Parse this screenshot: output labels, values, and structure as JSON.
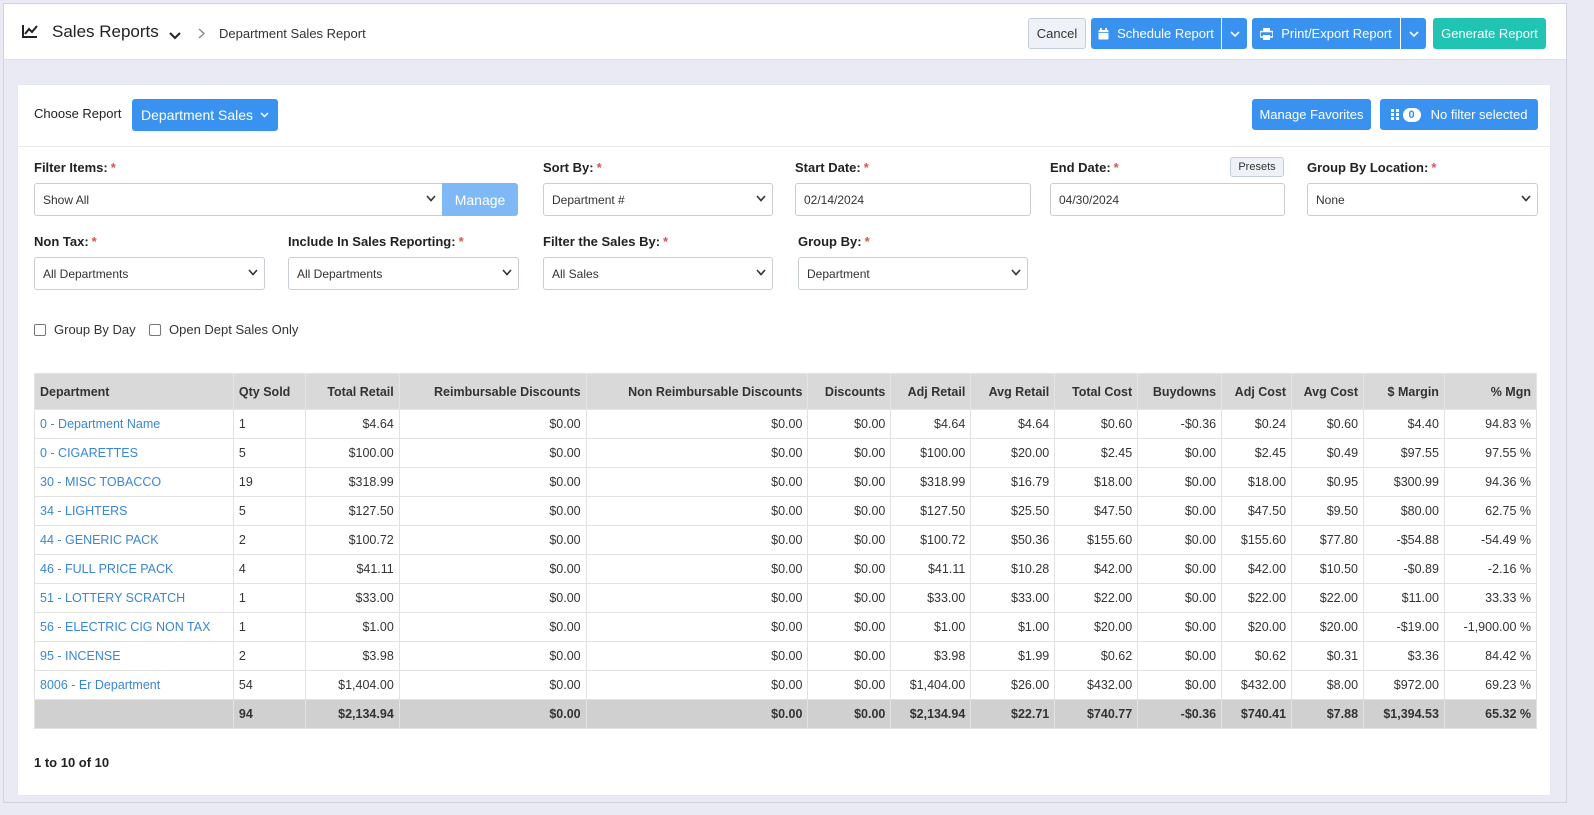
{
  "topbar": {
    "title": "Sales Reports",
    "breadcrumb": "Department Sales Report",
    "cancel_label": "Cancel",
    "schedule_label": "Schedule Report",
    "print_label": "Print/Export Report",
    "generate_label": "Generate Report"
  },
  "controls": {
    "choose_report_label": "Choose Report",
    "report_type": "Department Sales",
    "manage_favorites": "Manage Favorites",
    "filter_count": "0",
    "filter_status": "No filter selected"
  },
  "filters": {
    "filter_items": {
      "label": "Filter Items:",
      "value": "Show All",
      "manage_label": "Manage"
    },
    "sort_by": {
      "label": "Sort By:",
      "value": "Department #"
    },
    "start_date": {
      "label": "Start Date:",
      "value": "02/14/2024"
    },
    "end_date": {
      "label": "End Date:",
      "value": "04/30/2024",
      "presets_label": "Presets"
    },
    "group_by_location": {
      "label": "Group By Location:",
      "value": "None"
    },
    "non_tax": {
      "label": "Non Tax:",
      "value": "All Departments"
    },
    "include_in_sales": {
      "label": "Include In Sales Reporting:",
      "value": "All Departments"
    },
    "filter_sales_by": {
      "label": "Filter the Sales By:",
      "value": "All Sales"
    },
    "group_by": {
      "label": "Group By:",
      "value": "Department"
    },
    "group_by_day": "Group By Day",
    "open_dept_only": "Open Dept Sales Only"
  },
  "table": {
    "headers": [
      "Department",
      "Qty Sold",
      "Total Retail",
      "Reimbursable Discounts",
      "Non Reimbursable Discounts",
      "Discounts",
      "Adj Retail",
      "Avg Retail",
      "Total Cost",
      "Buydowns",
      "Adj Cost",
      "Avg Cost",
      "$ Margin",
      "% Mgn"
    ],
    "rows": [
      [
        "0 - Department Name",
        "1",
        "$4.64",
        "$0.00",
        "$0.00",
        "$0.00",
        "$4.64",
        "$4.64",
        "$0.60",
        "-$0.36",
        "$0.24",
        "$0.60",
        "$4.40",
        "94.83 %"
      ],
      [
        "0 - CIGARETTES",
        "5",
        "$100.00",
        "$0.00",
        "$0.00",
        "$0.00",
        "$100.00",
        "$20.00",
        "$2.45",
        "$0.00",
        "$2.45",
        "$0.49",
        "$97.55",
        "97.55 %"
      ],
      [
        "30 - MISC TOBACCO",
        "19",
        "$318.99",
        "$0.00",
        "$0.00",
        "$0.00",
        "$318.99",
        "$16.79",
        "$18.00",
        "$0.00",
        "$18.00",
        "$0.95",
        "$300.99",
        "94.36 %"
      ],
      [
        "34 - LIGHTERS",
        "5",
        "$127.50",
        "$0.00",
        "$0.00",
        "$0.00",
        "$127.50",
        "$25.50",
        "$47.50",
        "$0.00",
        "$47.50",
        "$9.50",
        "$80.00",
        "62.75 %"
      ],
      [
        "44 - GENERIC PACK",
        "2",
        "$100.72",
        "$0.00",
        "$0.00",
        "$0.00",
        "$100.72",
        "$50.36",
        "$155.60",
        "$0.00",
        "$155.60",
        "$77.80",
        "-$54.88",
        "-54.49 %"
      ],
      [
        "46 - FULL PRICE PACK",
        "4",
        "$41.11",
        "$0.00",
        "$0.00",
        "$0.00",
        "$41.11",
        "$10.28",
        "$42.00",
        "$0.00",
        "$42.00",
        "$10.50",
        "-$0.89",
        "-2.16 %"
      ],
      [
        "51 - LOTTERY SCRATCH",
        "1",
        "$33.00",
        "$0.00",
        "$0.00",
        "$0.00",
        "$33.00",
        "$33.00",
        "$22.00",
        "$0.00",
        "$22.00",
        "$22.00",
        "$11.00",
        "33.33 %"
      ],
      [
        "56 - ELECTRIC CIG NON TAX",
        "1",
        "$1.00",
        "$0.00",
        "$0.00",
        "$0.00",
        "$1.00",
        "$1.00",
        "$20.00",
        "$0.00",
        "$20.00",
        "$20.00",
        "-$19.00",
        "-1,900.00 %"
      ],
      [
        "95 - INCENSE",
        "2",
        "$3.98",
        "$0.00",
        "$0.00",
        "$0.00",
        "$3.98",
        "$1.99",
        "$0.62",
        "$0.00",
        "$0.62",
        "$0.31",
        "$3.36",
        "84.42 %"
      ],
      [
        "8006 - Er Department",
        "54",
        "$1,404.00",
        "$0.00",
        "$0.00",
        "$0.00",
        "$1,404.00",
        "$26.00",
        "$432.00",
        "$0.00",
        "$432.00",
        "$8.00",
        "$972.00",
        "69.23 %"
      ]
    ],
    "totals": [
      "",
      "94",
      "$2,134.94",
      "$0.00",
      "$0.00",
      "$0.00",
      "$2,134.94",
      "$22.71",
      "$740.77",
      "-$0.36",
      "$740.41",
      "$7.88",
      "$1,394.53",
      "65.32 %"
    ]
  },
  "pager": "1 to 10 of 10",
  "colors": {
    "primary": "#3a92f0",
    "teal": "#21c4b2",
    "link": "#3a86d4",
    "required": "#d9534f"
  },
  "icons": [
    "line-chart-icon",
    "chevron-down-icon",
    "chevron-right-icon",
    "calendar-icon",
    "printer-icon",
    "filter-grid-icon"
  ]
}
